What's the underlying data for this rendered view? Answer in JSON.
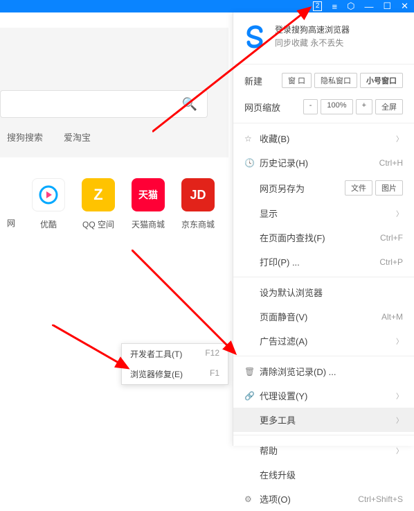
{
  "titlebar": {
    "tab_count": "2"
  },
  "menu_header": {
    "title": "登录搜狗高速浏览器",
    "subtitle": "同步收藏 永不丢失"
  },
  "rows": {
    "new": "新建",
    "window": "窗 口",
    "private": "隐私窗口",
    "small": "小号窗口",
    "zoom": "网页缩放",
    "zoom_val": "100%",
    "fullscreen": "全屏",
    "fav": "收藏(B)",
    "history": "历史记录(H)",
    "history_sc": "Ctrl+H",
    "saveas": "网页另存为",
    "file": "文件",
    "image": "图片",
    "show": "显示",
    "find": "在页面内查找(F)",
    "find_sc": "Ctrl+F",
    "print": "打印(P) ...",
    "print_sc": "Ctrl+P",
    "default": "设为默认浏览器",
    "mute": "页面静音(V)",
    "mute_sc": "Alt+M",
    "adfilter": "广告过滤(A)",
    "clear": "清除浏览记录(D) ...",
    "proxy": "代理设置(Y)",
    "more": "更多工具",
    "help": "帮助",
    "update": "在线升级",
    "options": "选项(O)",
    "options_sc": "Ctrl+Shift+S"
  },
  "submenu": {
    "dev": "开发者工具(T)",
    "dev_sc": "F12",
    "repair": "浏览器修复(E)",
    "repair_sc": "F1"
  },
  "search_tabs": {
    "a": "搜狗搜索",
    "b": "爱淘宝"
  },
  "tiles": {
    "youku": "优酷",
    "qq": "QQ 空间",
    "tmall": "天猫商城",
    "jd": "京东商城",
    "youku_t": ">",
    "qq_t": "Z",
    "tmall_t": "天猫",
    "jd_t": "JD"
  },
  "left_label": "网"
}
